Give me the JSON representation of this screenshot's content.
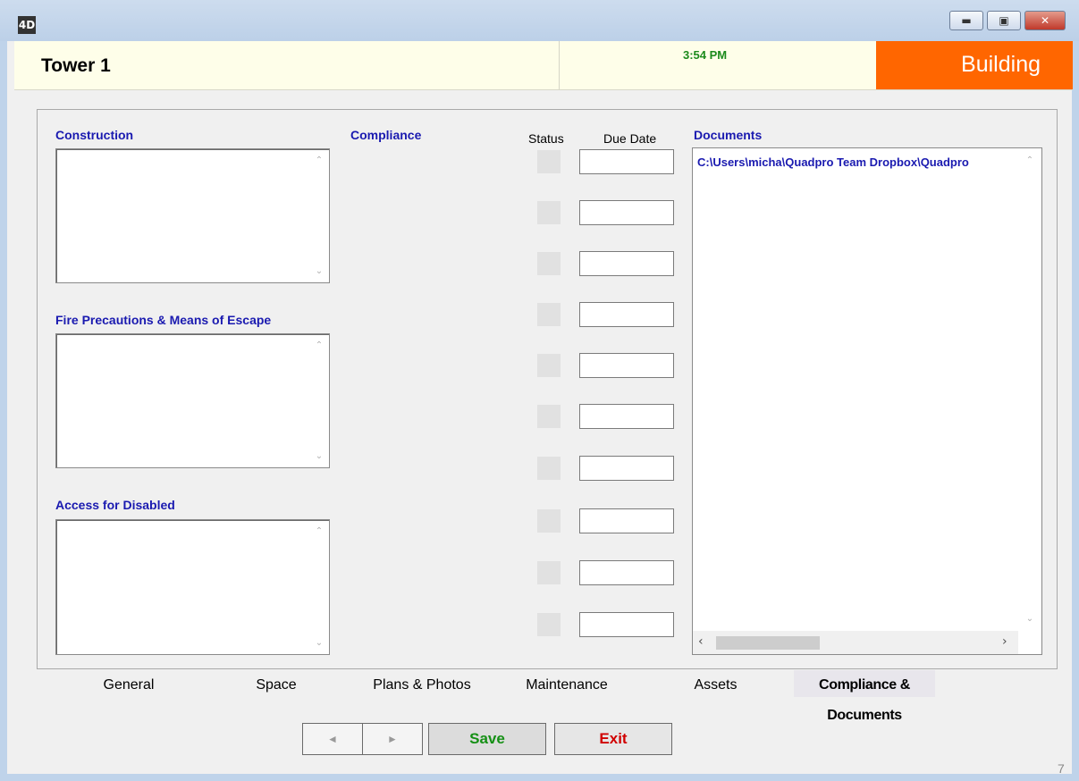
{
  "window": {
    "app_icon": "4D",
    "min_label": "▬",
    "max_label": "▣",
    "close_label": "✕"
  },
  "header": {
    "title": "Tower 1",
    "time": "3:54 PM",
    "section": "Building"
  },
  "form": {
    "construction_label": "Construction",
    "fire_label": "Fire Precautions & Means of Escape",
    "access_label": "Access for Disabled",
    "compliance_label": "Compliance",
    "status_header": "Status",
    "due_date_header": "Due Date",
    "documents_label": "Documents",
    "document_items": [
      "C:\\Users\\micha\\Quadpro Team Dropbox\\Quadpro"
    ]
  },
  "tabs": [
    "General",
    "Space",
    "Plans & Photos",
    "Maintenance",
    "Assets",
    "Compliance & Documents"
  ],
  "active_tab": "Compliance & Documents",
  "footer": {
    "prev_label": "◄",
    "next_label": "►",
    "save_label": "Save",
    "exit_label": "Exit",
    "page_number": "7"
  },
  "colors": {
    "accent_orange": "#ff6600",
    "label_blue": "#1a1ab0",
    "save_green": "#159015",
    "exit_red": "#d00000",
    "time_green": "#1c8a1c"
  }
}
